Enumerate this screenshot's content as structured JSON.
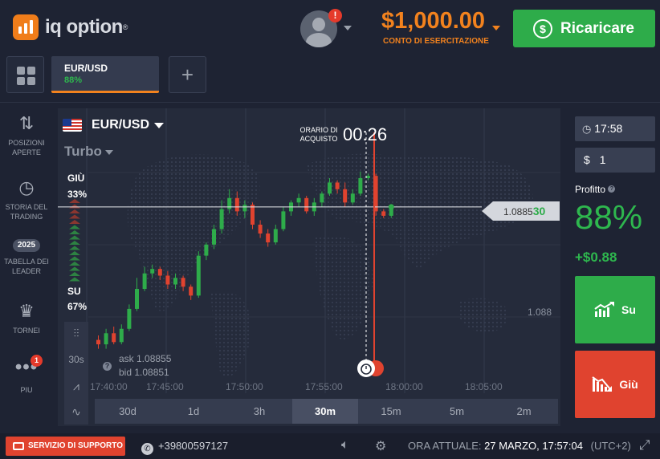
{
  "header": {
    "logo_text": "iq option",
    "logo_reg": "®",
    "notification_badge": "!",
    "balance": "$1,000.00",
    "balance_label": "CONTO DI ESERCITAZIONE",
    "recharge_label": "Ricaricare"
  },
  "tabs": {
    "active": {
      "name": "EUR/USD",
      "profit": "88%"
    },
    "add_label": "+"
  },
  "sidebar": {
    "items": [
      {
        "label": "POSIZIONI APERTE",
        "icon": "arrows-updown-icon"
      },
      {
        "label": "STORIA DEL TRADING",
        "icon": "history-icon"
      },
      {
        "label": "TABELLA DEI LEADER",
        "icon": "leaderboard-badge-icon",
        "year": "2025"
      },
      {
        "label": "TORNEI",
        "icon": "trophy-icon"
      },
      {
        "label": "PIU",
        "icon": "more-dots-icon",
        "badge": "1"
      }
    ]
  },
  "chart": {
    "pair": "EUR/USD",
    "mode": "Turbo",
    "down_label": "GIÙ",
    "down_pct": "33%",
    "up_label": "SU",
    "up_pct": "67%",
    "purchase_label": "ORARIO DI ACQUISTO",
    "purchase_time": "00:26",
    "current_price_main": "1.0885",
    "current_price_tail": "30",
    "y_label": "1.088",
    "ask": "ask 1.08855",
    "bid": "bid 1.08851",
    "tools": [
      "candles-icon",
      "30s",
      "indicator-icon",
      "drawing-icon"
    ],
    "x_labels": [
      "17:40:00",
      "17:45:00",
      "17:50:00",
      "17:55:00",
      "18:00:00",
      "18:05:00"
    ],
    "timeframes": [
      "30d",
      "1d",
      "3h",
      "30m",
      "15m",
      "5m",
      "2m"
    ],
    "active_timeframe": "30m"
  },
  "chart_data": {
    "type": "candlestick",
    "x_labels": [
      "17:40:00",
      "17:45:00",
      "17:50:00",
      "17:55:00",
      "18:00:00",
      "18:05:00"
    ],
    "y_label": "1.088",
    "current_price": 1.0885,
    "colors": {
      "up": "#2eac4a",
      "down": "#e0432f"
    },
    "candles": [
      {
        "o": 1.0879,
        "c": 1.08788,
        "h": 1.08792,
        "l": 1.08786
      },
      {
        "o": 1.08788,
        "c": 1.08793,
        "h": 1.08795,
        "l": 1.08786
      },
      {
        "o": 1.08793,
        "c": 1.08789,
        "h": 1.08796,
        "l": 1.08788
      },
      {
        "o": 1.08789,
        "c": 1.08795,
        "h": 1.08797,
        "l": 1.08788
      },
      {
        "o": 1.08795,
        "c": 1.08804,
        "h": 1.08806,
        "l": 1.08794
      },
      {
        "o": 1.08804,
        "c": 1.08813,
        "h": 1.08818,
        "l": 1.08803
      },
      {
        "o": 1.08813,
        "c": 1.0882,
        "h": 1.08823,
        "l": 1.08812
      },
      {
        "o": 1.0882,
        "c": 1.08822,
        "h": 1.08824,
        "l": 1.08818
      },
      {
        "o": 1.08822,
        "c": 1.08819,
        "h": 1.08823,
        "l": 1.08817
      },
      {
        "o": 1.08819,
        "c": 1.08815,
        "h": 1.08821,
        "l": 1.08813
      },
      {
        "o": 1.08815,
        "c": 1.08818,
        "h": 1.0882,
        "l": 1.08813
      },
      {
        "o": 1.08818,
        "c": 1.08814,
        "h": 1.08819,
        "l": 1.08812
      },
      {
        "o": 1.08814,
        "c": 1.0881,
        "h": 1.08815,
        "l": 1.08808
      },
      {
        "o": 1.0881,
        "c": 1.08828,
        "h": 1.0883,
        "l": 1.08809
      },
      {
        "o": 1.08828,
        "c": 1.08833,
        "h": 1.08834,
        "l": 1.08826
      },
      {
        "o": 1.08833,
        "c": 1.0884,
        "h": 1.08842,
        "l": 1.08831
      },
      {
        "o": 1.0884,
        "c": 1.08849,
        "h": 1.08853,
        "l": 1.08838
      },
      {
        "o": 1.08849,
        "c": 1.08854,
        "h": 1.08858,
        "l": 1.08847
      },
      {
        "o": 1.08854,
        "c": 1.08848,
        "h": 1.08857,
        "l": 1.08846
      },
      {
        "o": 1.08848,
        "c": 1.08851,
        "h": 1.08853,
        "l": 1.08845
      },
      {
        "o": 1.08851,
        "c": 1.08842,
        "h": 1.08852,
        "l": 1.0884
      },
      {
        "o": 1.08842,
        "c": 1.08838,
        "h": 1.08844,
        "l": 1.08836
      },
      {
        "o": 1.08838,
        "c": 1.08834,
        "h": 1.0884,
        "l": 1.08832
      },
      {
        "o": 1.08834,
        "c": 1.0884,
        "h": 1.08842,
        "l": 1.08833
      },
      {
        "o": 1.0884,
        "c": 1.08848,
        "h": 1.0885,
        "l": 1.08839
      },
      {
        "o": 1.08848,
        "c": 1.08852,
        "h": 1.08853,
        "l": 1.08846
      },
      {
        "o": 1.08852,
        "c": 1.08854,
        "h": 1.08856,
        "l": 1.0885
      },
      {
        "o": 1.08854,
        "c": 1.08848,
        "h": 1.08855,
        "l": 1.08847
      },
      {
        "o": 1.08848,
        "c": 1.08852,
        "h": 1.08854,
        "l": 1.08846
      },
      {
        "o": 1.08852,
        "c": 1.08856,
        "h": 1.08857,
        "l": 1.0885
      },
      {
        "o": 1.08856,
        "c": 1.08861,
        "h": 1.08863,
        "l": 1.08855
      },
      {
        "o": 1.08861,
        "c": 1.08858,
        "h": 1.08862,
        "l": 1.08856
      },
      {
        "o": 1.08858,
        "c": 1.08852,
        "h": 1.08861,
        "l": 1.0885
      },
      {
        "o": 1.08852,
        "c": 1.08856,
        "h": 1.08858,
        "l": 1.08851
      },
      {
        "o": 1.08856,
        "c": 1.08863,
        "h": 1.08866,
        "l": 1.08855
      },
      {
        "o": 1.08863,
        "c": 1.08864,
        "h": 1.08865,
        "l": 1.08862
      },
      {
        "o": 1.08864,
        "c": 1.08848,
        "h": 1.08865,
        "l": 1.08846
      },
      {
        "o": 1.08848,
        "c": 1.08846,
        "h": 1.08849,
        "l": 1.08845
      },
      {
        "o": 1.08846,
        "c": 1.0885,
        "h": 1.08851,
        "l": 1.08845
      }
    ]
  },
  "right_panel": {
    "time": "17:58",
    "amount_currency": "$",
    "amount": "1",
    "profit_label": "Profitto",
    "profit_pct": "88%",
    "profit_amount": "+$0.88",
    "up_label": "Su",
    "down_label": "Giù"
  },
  "footer": {
    "support_label": "SERVIZIO DI SUPPORTO",
    "phone": "+39800597127",
    "time_label": "ORA ATTUALE:",
    "datetime": "27 MARZO, 17:57:04",
    "timezone": "(UTC+2)"
  }
}
